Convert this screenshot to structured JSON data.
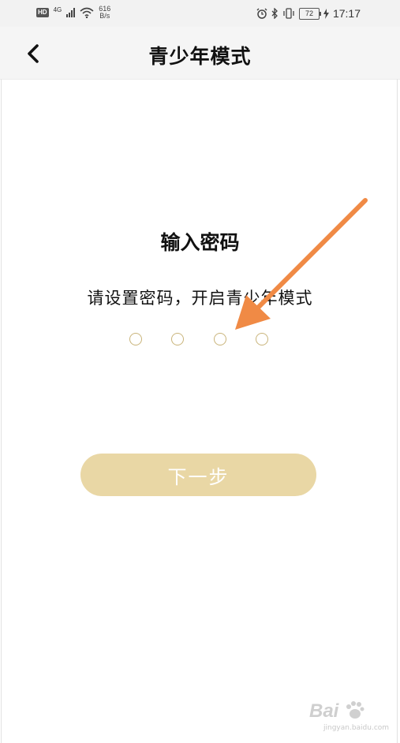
{
  "status_bar": {
    "hd": "HD",
    "network": "4G",
    "speed_value": "616",
    "speed_unit": "B/s",
    "battery": "72",
    "time": "17:17"
  },
  "nav": {
    "title": "青少年模式",
    "back_icon": "chevron-left-icon"
  },
  "main": {
    "heading": "输入密码",
    "subtitle": "请设置密码，开启青少年模式",
    "pin_slots": 4,
    "next_label": "下一步"
  },
  "watermark": {
    "logo": "Bai",
    "sub": "jingyan.baidu.com"
  },
  "colors": {
    "button_bg": "#e9d7a5",
    "pin_ring": "#c9b47a",
    "arrow": "#f08a45",
    "navbar_bg": "#f5f5f5"
  }
}
